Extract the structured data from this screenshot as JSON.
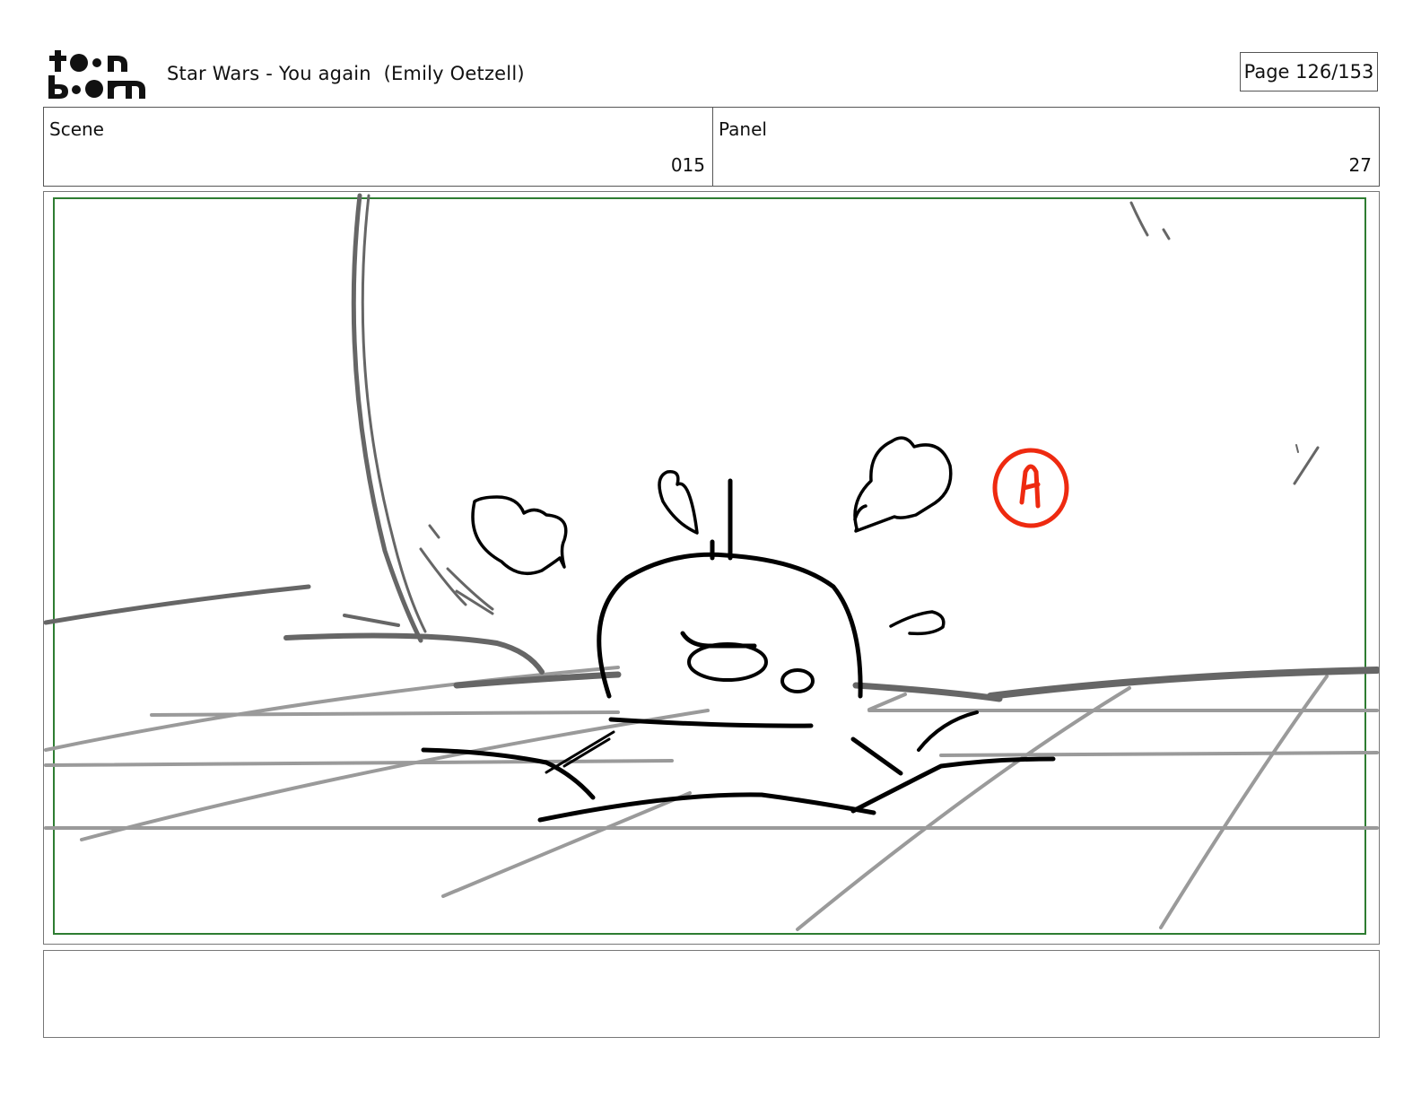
{
  "header": {
    "logo_text_top": "toon",
    "logo_text_bottom": "boom",
    "title": "Star Wars - You again  (Emily Oetzell)",
    "page": "Page 126/153"
  },
  "scene": {
    "label": "Scene",
    "value": "015"
  },
  "panel": {
    "label": "Panel",
    "value": "27"
  },
  "artwork": {
    "safe_area_color": "#2e7d32",
    "ink_color": "#000000",
    "rough_color": "#666666",
    "floor_color": "#9a9a9a",
    "marker_color": "#ee2a10",
    "marker_letter": "A"
  },
  "notes": {
    "text": ""
  }
}
